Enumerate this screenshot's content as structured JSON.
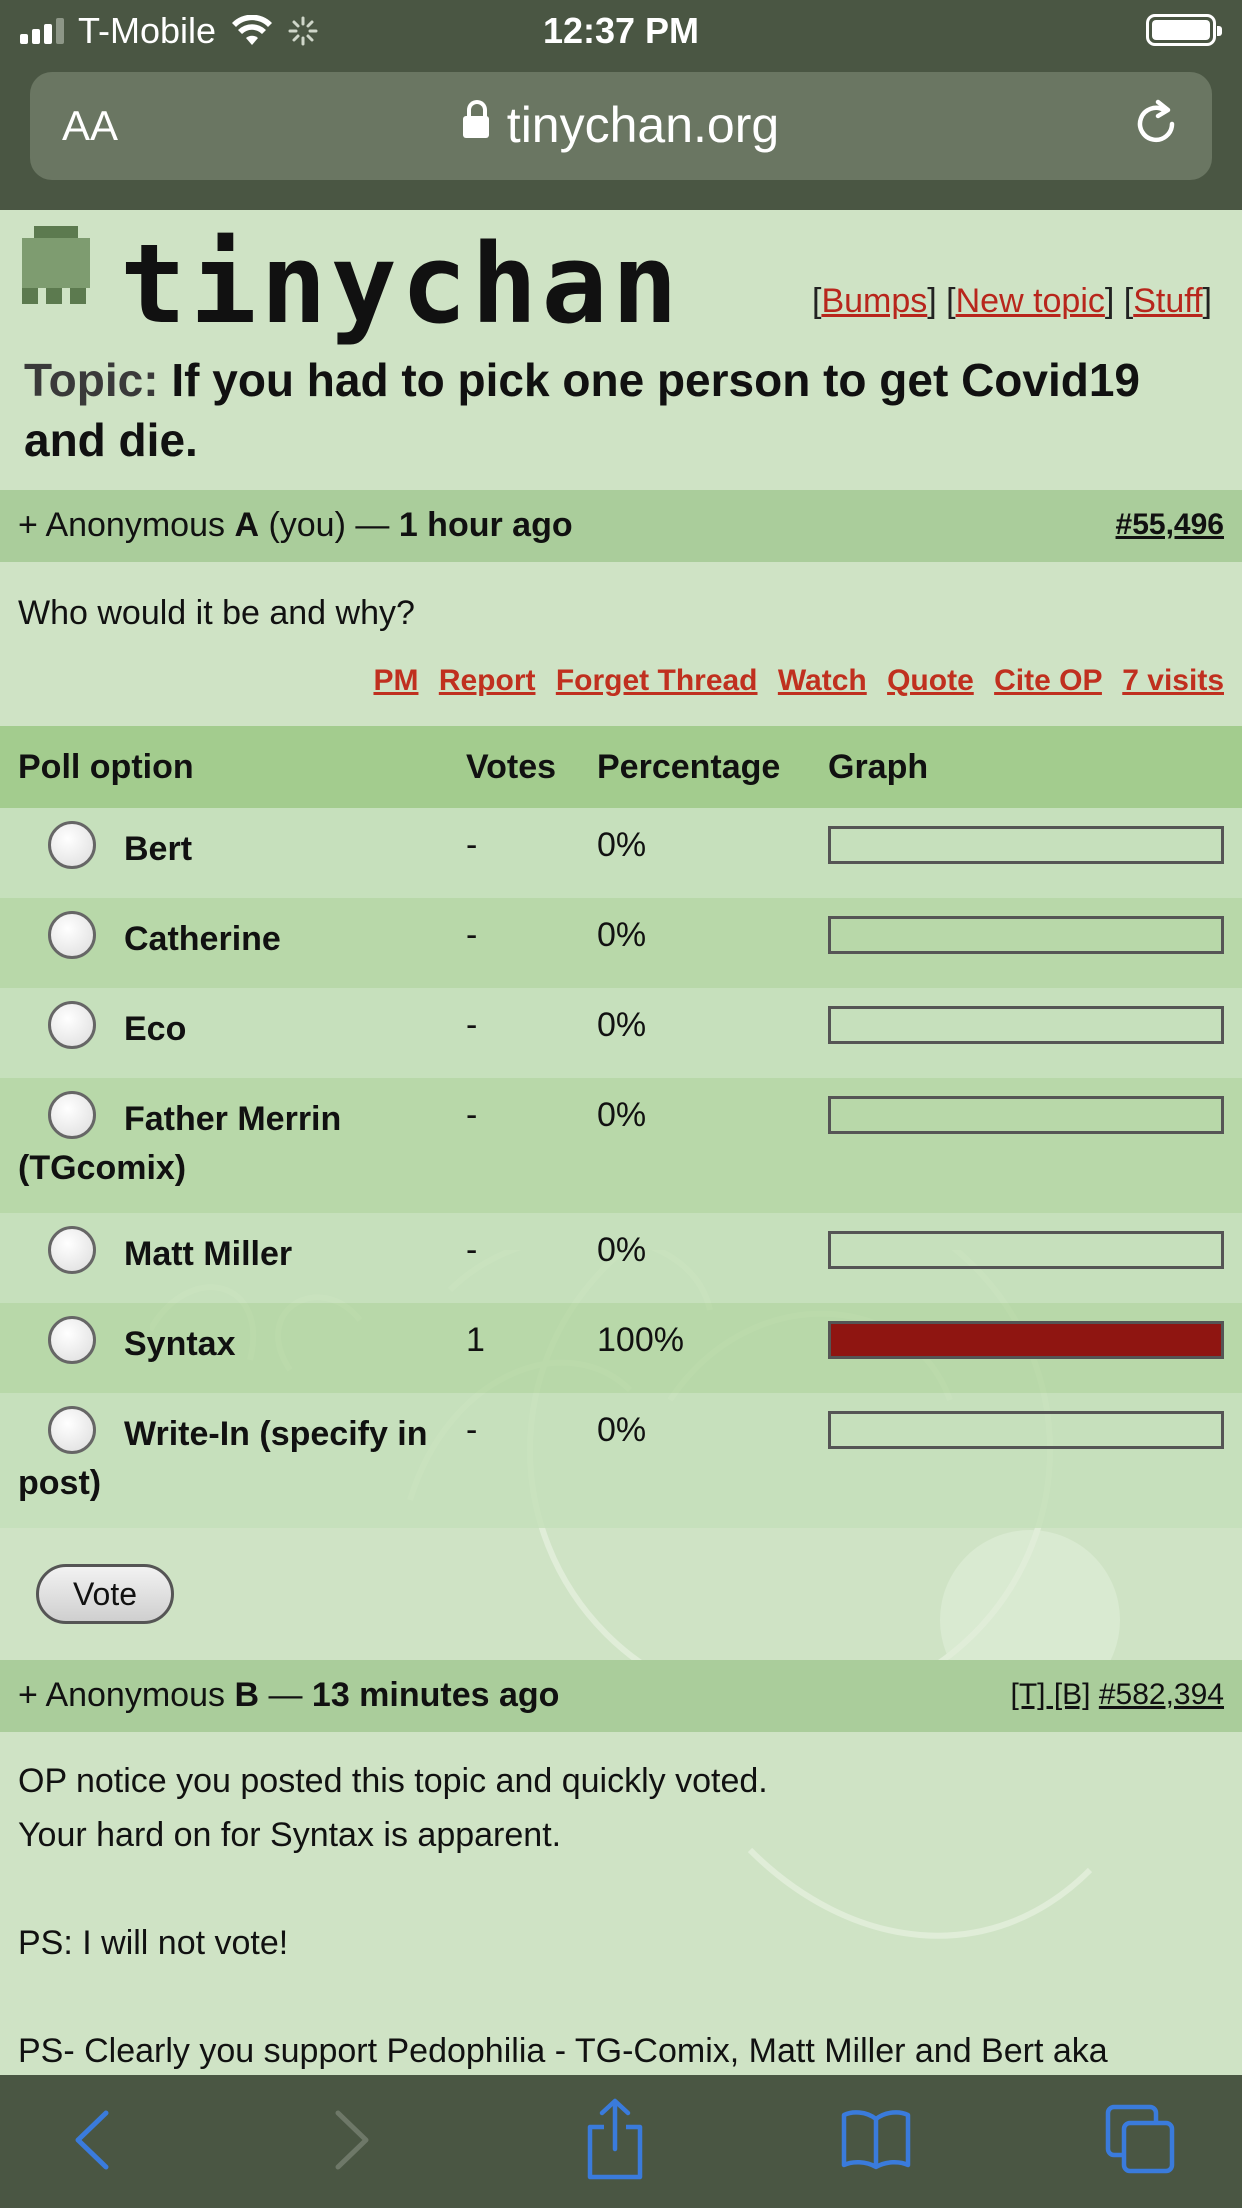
{
  "statusbar": {
    "carrier": "T-Mobile",
    "time": "12:37 PM"
  },
  "urlbar": {
    "text_size_label": "AA",
    "domain": "tinychan.org"
  },
  "header": {
    "logo_text": "tinychan",
    "links": [
      "Bumps",
      "New topic",
      "Stuff"
    ],
    "topic_label": "Topic:",
    "topic_title": "If you had to pick one person to get Covid19 and die."
  },
  "post1": {
    "plus": "+",
    "author_prefix": "Anonymous",
    "author_letter": "A",
    "author_suffix": "(you) —",
    "time": "1 hour ago",
    "number": "#55,496",
    "body": "Who would it be and why?",
    "actions": [
      "PM",
      "Report",
      "Forget Thread",
      "Watch",
      "Quote",
      "Cite OP",
      "7 visits"
    ]
  },
  "poll": {
    "headers": {
      "option": "Poll option",
      "votes": "Votes",
      "percentage": "Percentage",
      "graph": "Graph"
    },
    "options": [
      {
        "label": "Bert",
        "votes": "-",
        "percentage": "0%",
        "fraction": 0
      },
      {
        "label": "Catherine",
        "votes": "-",
        "percentage": "0%",
        "fraction": 0
      },
      {
        "label": "Eco",
        "votes": "-",
        "percentage": "0%",
        "fraction": 0
      },
      {
        "label": "Father Merrin (TGcomix)",
        "votes": "-",
        "percentage": "0%",
        "fraction": 0
      },
      {
        "label": "Matt Miller",
        "votes": "-",
        "percentage": "0%",
        "fraction": 0
      },
      {
        "label": "Syntax",
        "votes": "1",
        "percentage": "100%",
        "fraction": 1
      },
      {
        "label": "Write-In (specify in post)",
        "votes": "-",
        "percentage": "0%",
        "fraction": 0
      }
    ],
    "vote_label": "Vote"
  },
  "post2": {
    "plus": "+",
    "author_prefix": "Anonymous",
    "author_letter": "B",
    "dash": "—",
    "time": "13 minutes ago",
    "flags": "[T] [B]",
    "number": "#582,394",
    "lines": [
      "OP notice you posted this topic and quickly voted.",
      "Your hard on for Syntax is apparent.",
      "",
      "PS: I will not vote!",
      "",
      "PS- Clearly you support Pedophilia - TG-Comix, Matt Miller and Bert aka"
    ]
  },
  "colors": {
    "page_bg": "#cfe3c5",
    "chrome_bg": "#4a5643",
    "link_red": "#c0301f",
    "bar_fill": "#8f1511",
    "ios_blue": "#3a7bdc"
  }
}
